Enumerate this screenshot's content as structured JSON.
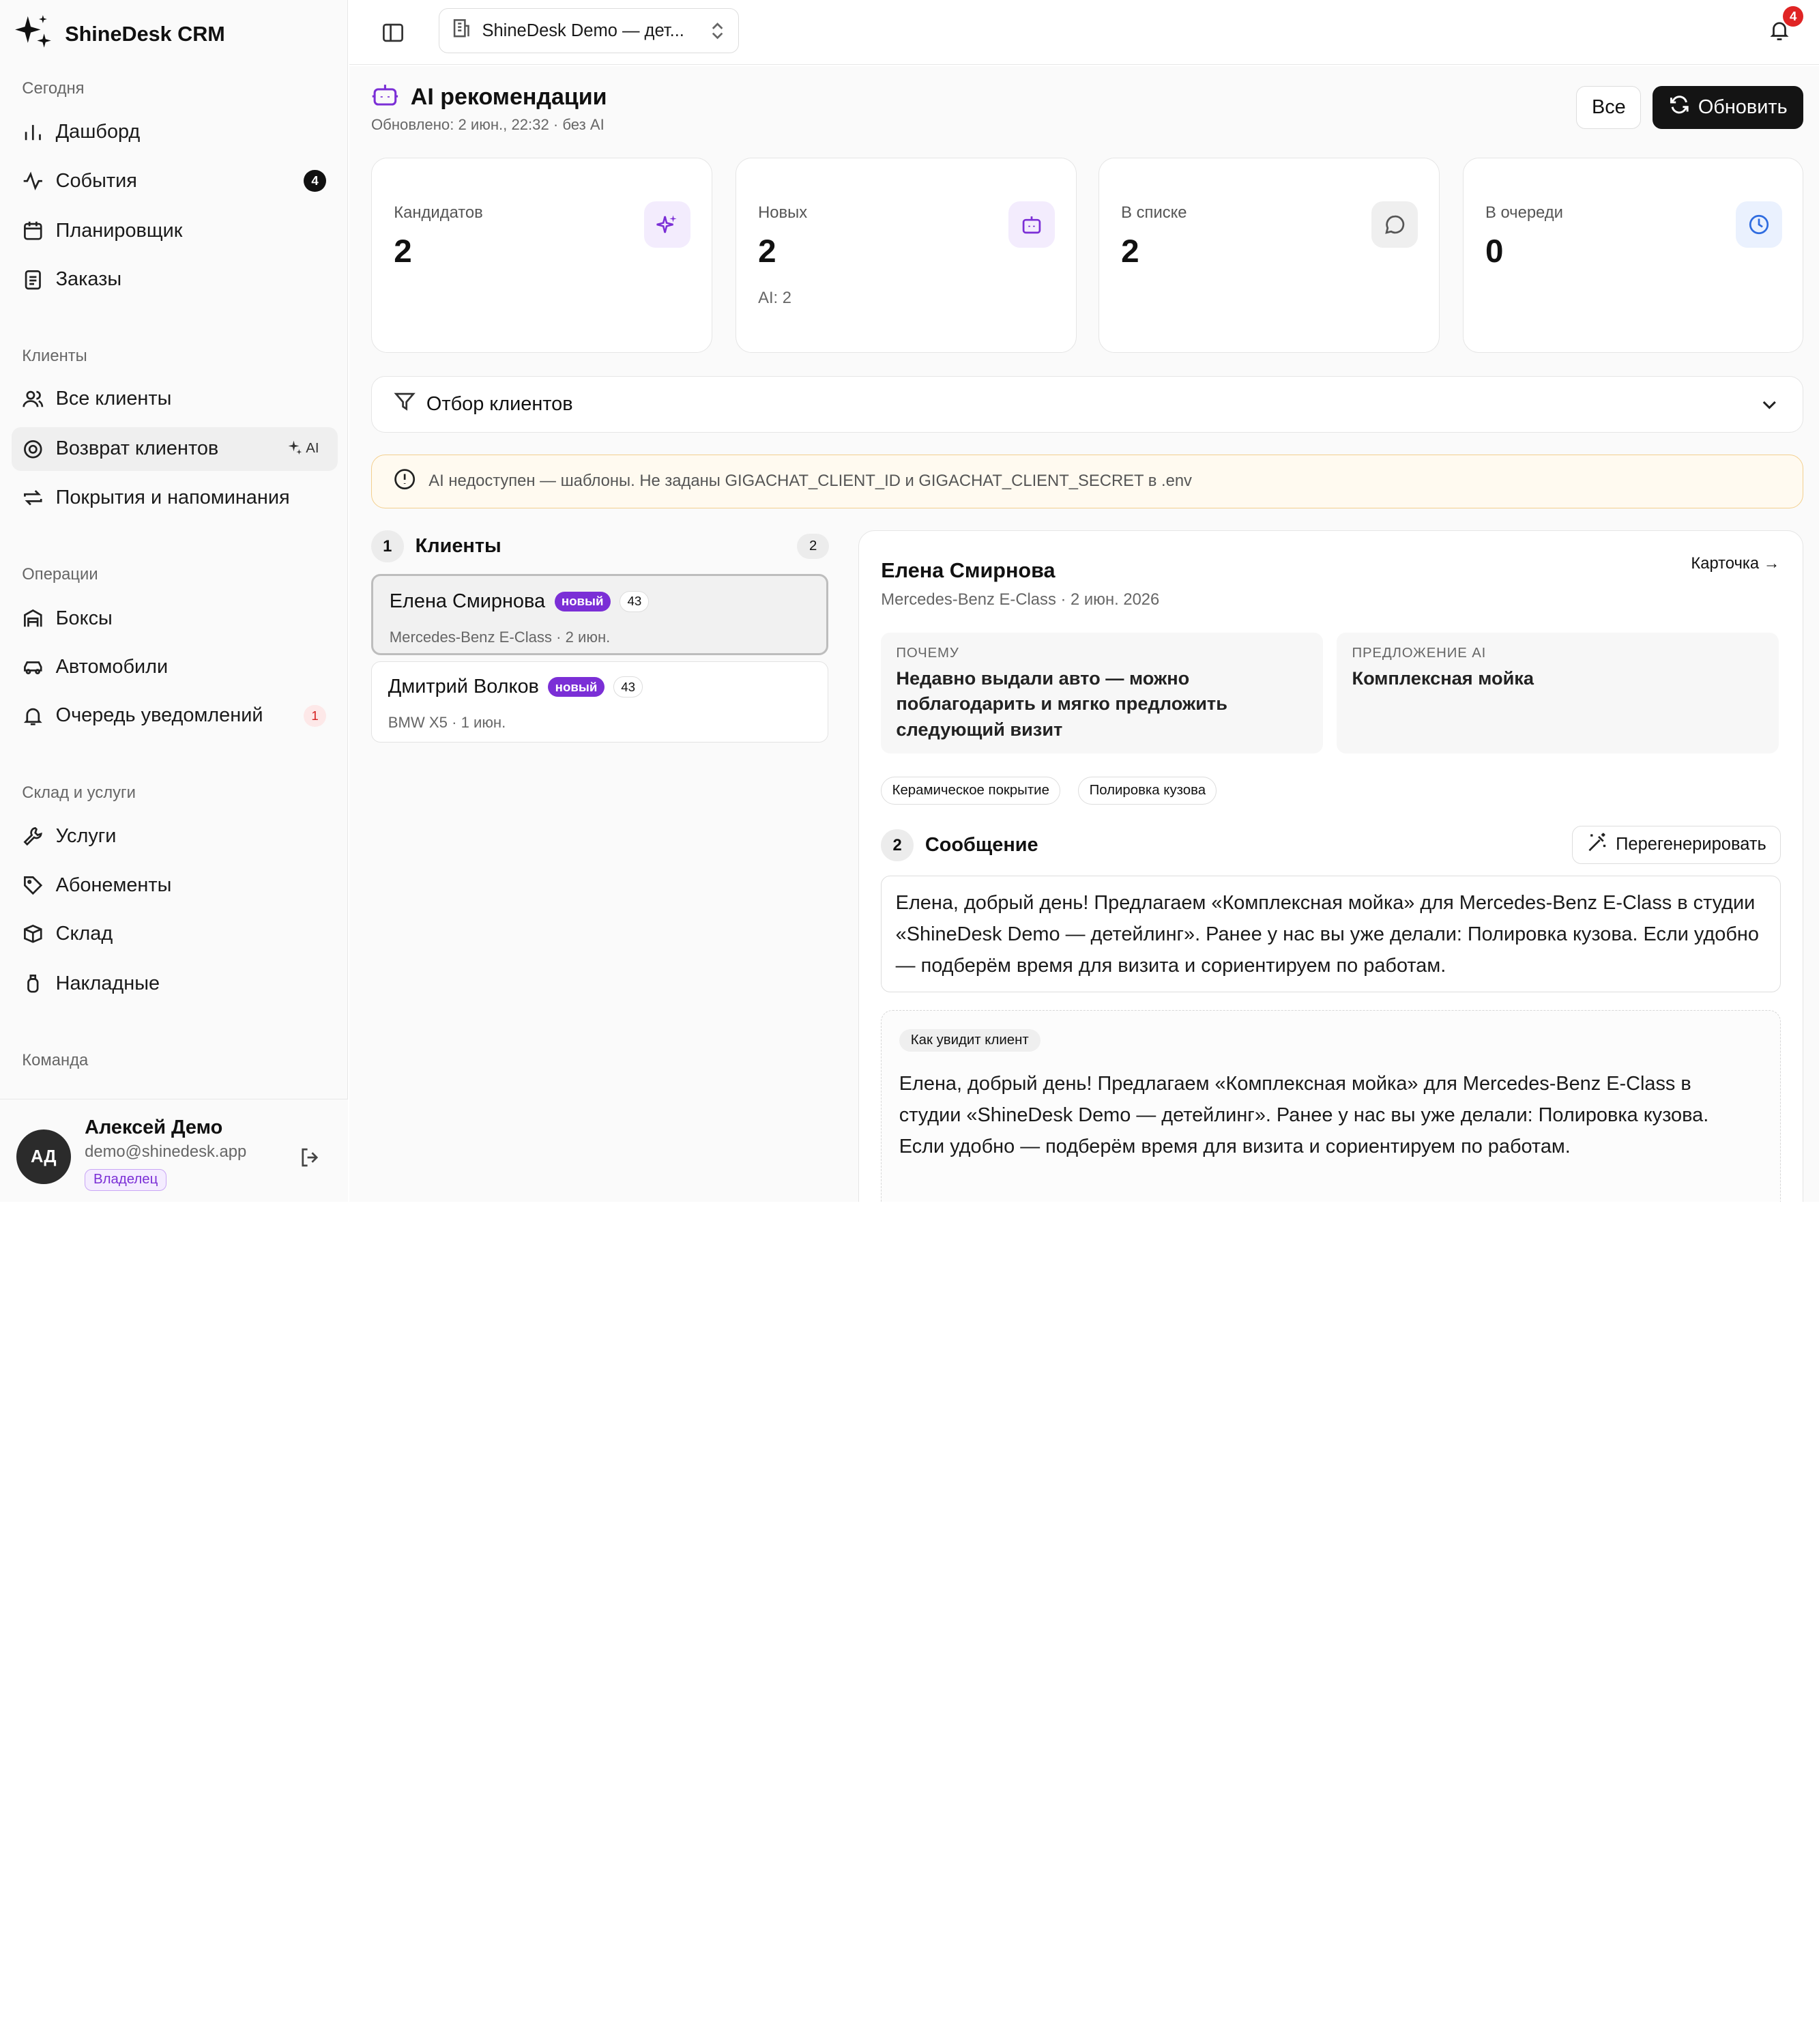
{
  "app": {
    "brand": "ShineDesk CRM"
  },
  "sidebar": {
    "sections": [
      {
        "title": "Сегодня"
      },
      {
        "title": "Клиенты"
      },
      {
        "title": "Операции"
      },
      {
        "title": "Склад и услуги"
      },
      {
        "title": "Команда"
      }
    ],
    "items": [
      {
        "label": "Дашборд"
      },
      {
        "label": "События",
        "badge": "4"
      },
      {
        "label": "Планировщик"
      },
      {
        "label": "Заказы"
      },
      {
        "label": "Все клиенты"
      },
      {
        "label": "Возврат клиентов",
        "tag": "AI"
      },
      {
        "label": "Покрытия и напоминания"
      },
      {
        "label": "Боксы"
      },
      {
        "label": "Автомобили"
      },
      {
        "label": "Очередь уведомлений",
        "badge": "1"
      },
      {
        "label": "Услуги"
      },
      {
        "label": "Абонементы"
      },
      {
        "label": "Склад"
      },
      {
        "label": "Накладные"
      }
    ],
    "user": {
      "initials": "АД",
      "name": "Алексей Демо",
      "email": "demo@shinedesk.app",
      "role": "Владелец"
    }
  },
  "topbar": {
    "org": "ShineDesk Demo — дет...",
    "notifications": "4"
  },
  "page": {
    "title": "AI рекомендации",
    "subtitle": "Обновлено: 2 июн., 22:32 · без AI",
    "btn_all": "Все",
    "btn_refresh": "Обновить"
  },
  "stats": [
    {
      "label": "Кандидатов",
      "value": "2",
      "sub": "",
      "icon": "sparkles-icon"
    },
    {
      "label": "Новых",
      "value": "2",
      "sub": "AI: 2",
      "icon": "robot-icon"
    },
    {
      "label": "В списке",
      "value": "2",
      "sub": "",
      "icon": "message-icon"
    },
    {
      "label": "В очереди",
      "value": "0",
      "sub": "",
      "icon": "clock-icon"
    }
  ],
  "filter": {
    "label": "Отбор клиентов"
  },
  "alert": {
    "text": "AI недоступен — шаблоны. Не заданы GIGACHAT_CLIENT_ID и GIGACHAT_CLIENT_SECRET в .env"
  },
  "clients": {
    "step": "1",
    "title": "Клиенты",
    "count": "2",
    "list": [
      {
        "name": "Елена Смирнова",
        "tag": "новый",
        "score": "43",
        "meta": "Mercedes-Benz E-Class · 2 июн."
      },
      {
        "name": "Дмитрий Волков",
        "tag": "новый",
        "score": "43",
        "meta": "BMW X5 · 1 июн."
      }
    ]
  },
  "detail": {
    "name": "Елена Смирнова",
    "sub": "Mercedes-Benz E-Class · 2 июн. 2026",
    "card_link": "Карточка →",
    "why_label": "ПОЧЕМУ",
    "why_text": "Недавно выдали авто — можно поблагодарить и мягко предложить следующий визит",
    "offer_label": "ПРЕДЛОЖЕНИЕ AI",
    "offer_text": "Комплексная мойка",
    "chips": [
      "Керамическое покрытие",
      "Полировка кузова"
    ],
    "msg_step": "2",
    "msg_title": "Сообщение",
    "regen": "Перегенерировать",
    "message": "Елена, добрый день! Предлагаем «Комплексная мойка» для Mercedes-Benz E-Class в студии «ShineDesk Demo — детейлинг». Ранее у нас вы уже делали: Полировка кузова. Если удобно — подберём время для визита и сориентируем по работам.",
    "preview_tag": "Как увидит клиент",
    "preview_text": "Елена, добрый день! Предлагаем «Комплексная мойка» для Mercedes-Benz E-Class в студии «ShineDesk Demo — детейлинг». Ранее у нас вы уже делали: Полировка кузова. Если удобно — подберём время для визита и сориентируем по работам."
  }
}
